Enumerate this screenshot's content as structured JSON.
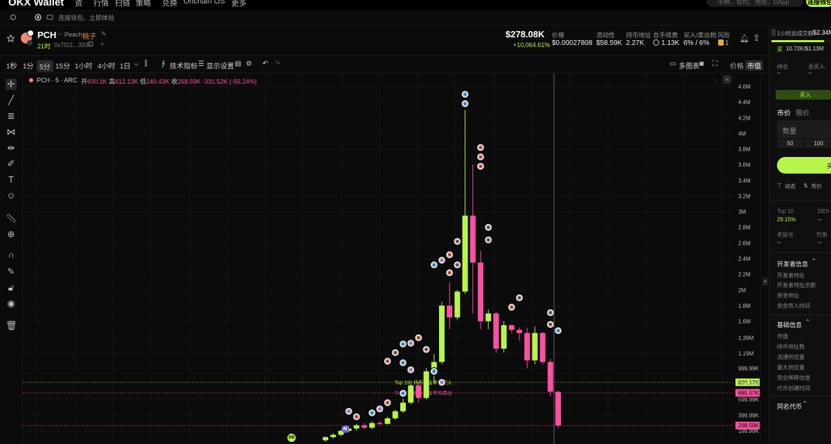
{
  "topbar": {
    "logo": "OKX Wallet",
    "nav": [
      "资",
      "行情",
      "扫链",
      "策略",
      "兑换",
      "Onchain OS",
      "更多"
    ],
    "search_placeholder": "币种、合约、地址、DApp",
    "connect_label": "连接钱包"
  },
  "subbar": {
    "connect_hint": "连接钱包，立即体验"
  },
  "token": {
    "symbol": "PCH",
    "name": "Peach",
    "cn_name": "桃子",
    "age": "21时",
    "address": "0x7f22...393b"
  },
  "stats": {
    "market_cap": "$278.08K",
    "change": "+10,064.61%",
    "price_label": "价格",
    "price": "$0.00027808",
    "liquidity_label": "流动性",
    "liquidity": "$58.59K",
    "holders_label": "持币地址",
    "holders": "2.27K",
    "fees_label": "总手续费",
    "fees": "1.13K",
    "tax_label": "买入/卖出税",
    "tax": "6% / 6%",
    "risk_label": "风险",
    "risk": "1"
  },
  "toolbar": {
    "timeframes": [
      "1秒",
      "1分",
      "5分",
      "15分",
      "1小时",
      "4小时",
      "1日"
    ],
    "active_timeframe": "5分",
    "indicators": "技术指标",
    "display_settings": "显示设置",
    "multi_chart": "多图表",
    "price_toggle": "价格",
    "mcap_toggle": "市值"
  },
  "chart_data": {
    "type": "candlestick",
    "legend": {
      "symbol_line": "PCH · 5 · ARC",
      "open_label": "开",
      "open": "600.1K",
      "high_label": "高",
      "high": "612.13K",
      "low_label": "低",
      "low": "240.43K",
      "close_label": "收",
      "close": "268.59K",
      "change": "-331.52K (-55.24%)"
    },
    "y_ticks": [
      "4.6M",
      "4.4M",
      "4.2M",
      "4M",
      "3.8M",
      "3.6M",
      "3.4M",
      "3.2M",
      "3M",
      "2.8M",
      "2.6M",
      "2.4M",
      "2.2M",
      "2M",
      "1.8M",
      "1.6M",
      "1.39M",
      "1.19M",
      "999.99K",
      "799.99K",
      "599.99K",
      "399.99K",
      "199.99K"
    ],
    "y_tick_values": [
      4600,
      4400,
      4200,
      4000,
      3800,
      3600,
      3400,
      3200,
      3000,
      2800,
      2600,
      2400,
      2200,
      2000,
      1800,
      1600,
      1390,
      1190,
      1000,
      800,
      600,
      400,
      200
    ],
    "candles": [
      {
        "o": 80,
        "h": 130,
        "l": 60,
        "c": 120
      },
      {
        "o": 120,
        "h": 170,
        "l": 100,
        "c": 150
      },
      {
        "o": 150,
        "h": 210,
        "l": 130,
        "c": 200
      },
      {
        "o": 200,
        "h": 260,
        "l": 180,
        "c": 230
      },
      {
        "o": 230,
        "h": 290,
        "l": 200,
        "c": 270
      },
      {
        "o": 270,
        "h": 300,
        "l": 220,
        "c": 240
      },
      {
        "o": 240,
        "h": 320,
        "l": 220,
        "c": 300
      },
      {
        "o": 300,
        "h": 330,
        "l": 280,
        "c": 290
      },
      {
        "o": 290,
        "h": 380,
        "l": 280,
        "c": 360
      },
      {
        "o": 360,
        "h": 470,
        "l": 340,
        "c": 450
      },
      {
        "o": 450,
        "h": 610,
        "l": 430,
        "c": 560
      },
      {
        "o": 560,
        "h": 800,
        "l": 540,
        "c": 780
      },
      {
        "o": 780,
        "h": 830,
        "l": 560,
        "c": 620
      },
      {
        "o": 620,
        "h": 1000,
        "l": 600,
        "c": 960
      },
      {
        "o": 960,
        "h": 1180,
        "l": 800,
        "c": 1080
      },
      {
        "o": 1080,
        "h": 1850,
        "l": 1050,
        "c": 1800
      },
      {
        "o": 1800,
        "h": 2100,
        "l": 1500,
        "c": 1650
      },
      {
        "o": 1650,
        "h": 2000,
        "l": 1620,
        "c": 1980
      },
      {
        "o": 1980,
        "h": 4300,
        "l": 1950,
        "c": 2950
      },
      {
        "o": 2950,
        "h": 3600,
        "l": 1700,
        "c": 2350
      },
      {
        "o": 2350,
        "h": 2500,
        "l": 1500,
        "c": 1600
      },
      {
        "o": 1600,
        "h": 1750,
        "l": 1500,
        "c": 1700
      },
      {
        "o": 1700,
        "h": 1720,
        "l": 1200,
        "c": 1250
      },
      {
        "o": 1250,
        "h": 1600,
        "l": 1200,
        "c": 1550
      },
      {
        "o": 1550,
        "h": 1560,
        "l": 1450,
        "c": 1490
      },
      {
        "o": 1490,
        "h": 1520,
        "l": 1350,
        "c": 1450
      },
      {
        "o": 1450,
        "h": 1520,
        "l": 1000,
        "c": 1100
      },
      {
        "o": 1100,
        "h": 1530,
        "l": 1050,
        "c": 1450
      },
      {
        "o": 1450,
        "h": 1460,
        "l": 1050,
        "c": 1080
      },
      {
        "o": 1080,
        "h": 1120,
        "l": 640,
        "c": 700
      },
      {
        "o": 700,
        "h": 712,
        "l": 240,
        "c": 268
      }
    ],
    "ref_lines": [
      {
        "label": "Top 100 持币地址平均买入",
        "value": 820,
        "tag": "820.17K",
        "color": "#b8f54a"
      },
      {
        "label": "Top 100 持币地址平均卖出",
        "value": 686,
        "tag": "685.57K",
        "color": "#ff4fa3"
      },
      {
        "label": "",
        "value": 268.59,
        "tag": "268.59K",
        "color": "#ff4fa3"
      }
    ],
    "markers": [
      "M",
      "DB"
    ]
  },
  "rightpanel": {
    "vol_label": "1小时总成交额",
    "vol_value": "$2.34M",
    "buy_prefix": "买",
    "buy_value": "10.72K/$1.13M",
    "position_label": "持仓",
    "position_value": "--",
    "total_buy_label": "总买入",
    "total_buy_value": "--",
    "buy_tab": "买入",
    "market_label": "市价",
    "limit_label": "限价",
    "amount_placeholder": "数量",
    "quick_50": "50",
    "quick_100": "100",
    "submit_label": "买",
    "dynamic_label": "动态",
    "market2_label": "市价",
    "top10_label": "Top 10",
    "top10_value": "29.15%",
    "dev_label": "DEV",
    "dev_value": "--",
    "rat_label": "老鼠仓",
    "rat_value": "--",
    "fish_label": "钓鱼",
    "fish_value": "--",
    "dev_info_title": "开发者信息",
    "dev_info_items": [
      "开发者地址",
      "开发者地址余额",
      "资金地址",
      "资金转入时间"
    ],
    "basic_info_title": "基础信息",
    "basic_info_items": [
      "市值",
      "持币地址数",
      "流通供应量",
      "最大供应量",
      "完全稀释估值",
      "代币创建时间"
    ],
    "same_name_title": "同名代币"
  }
}
